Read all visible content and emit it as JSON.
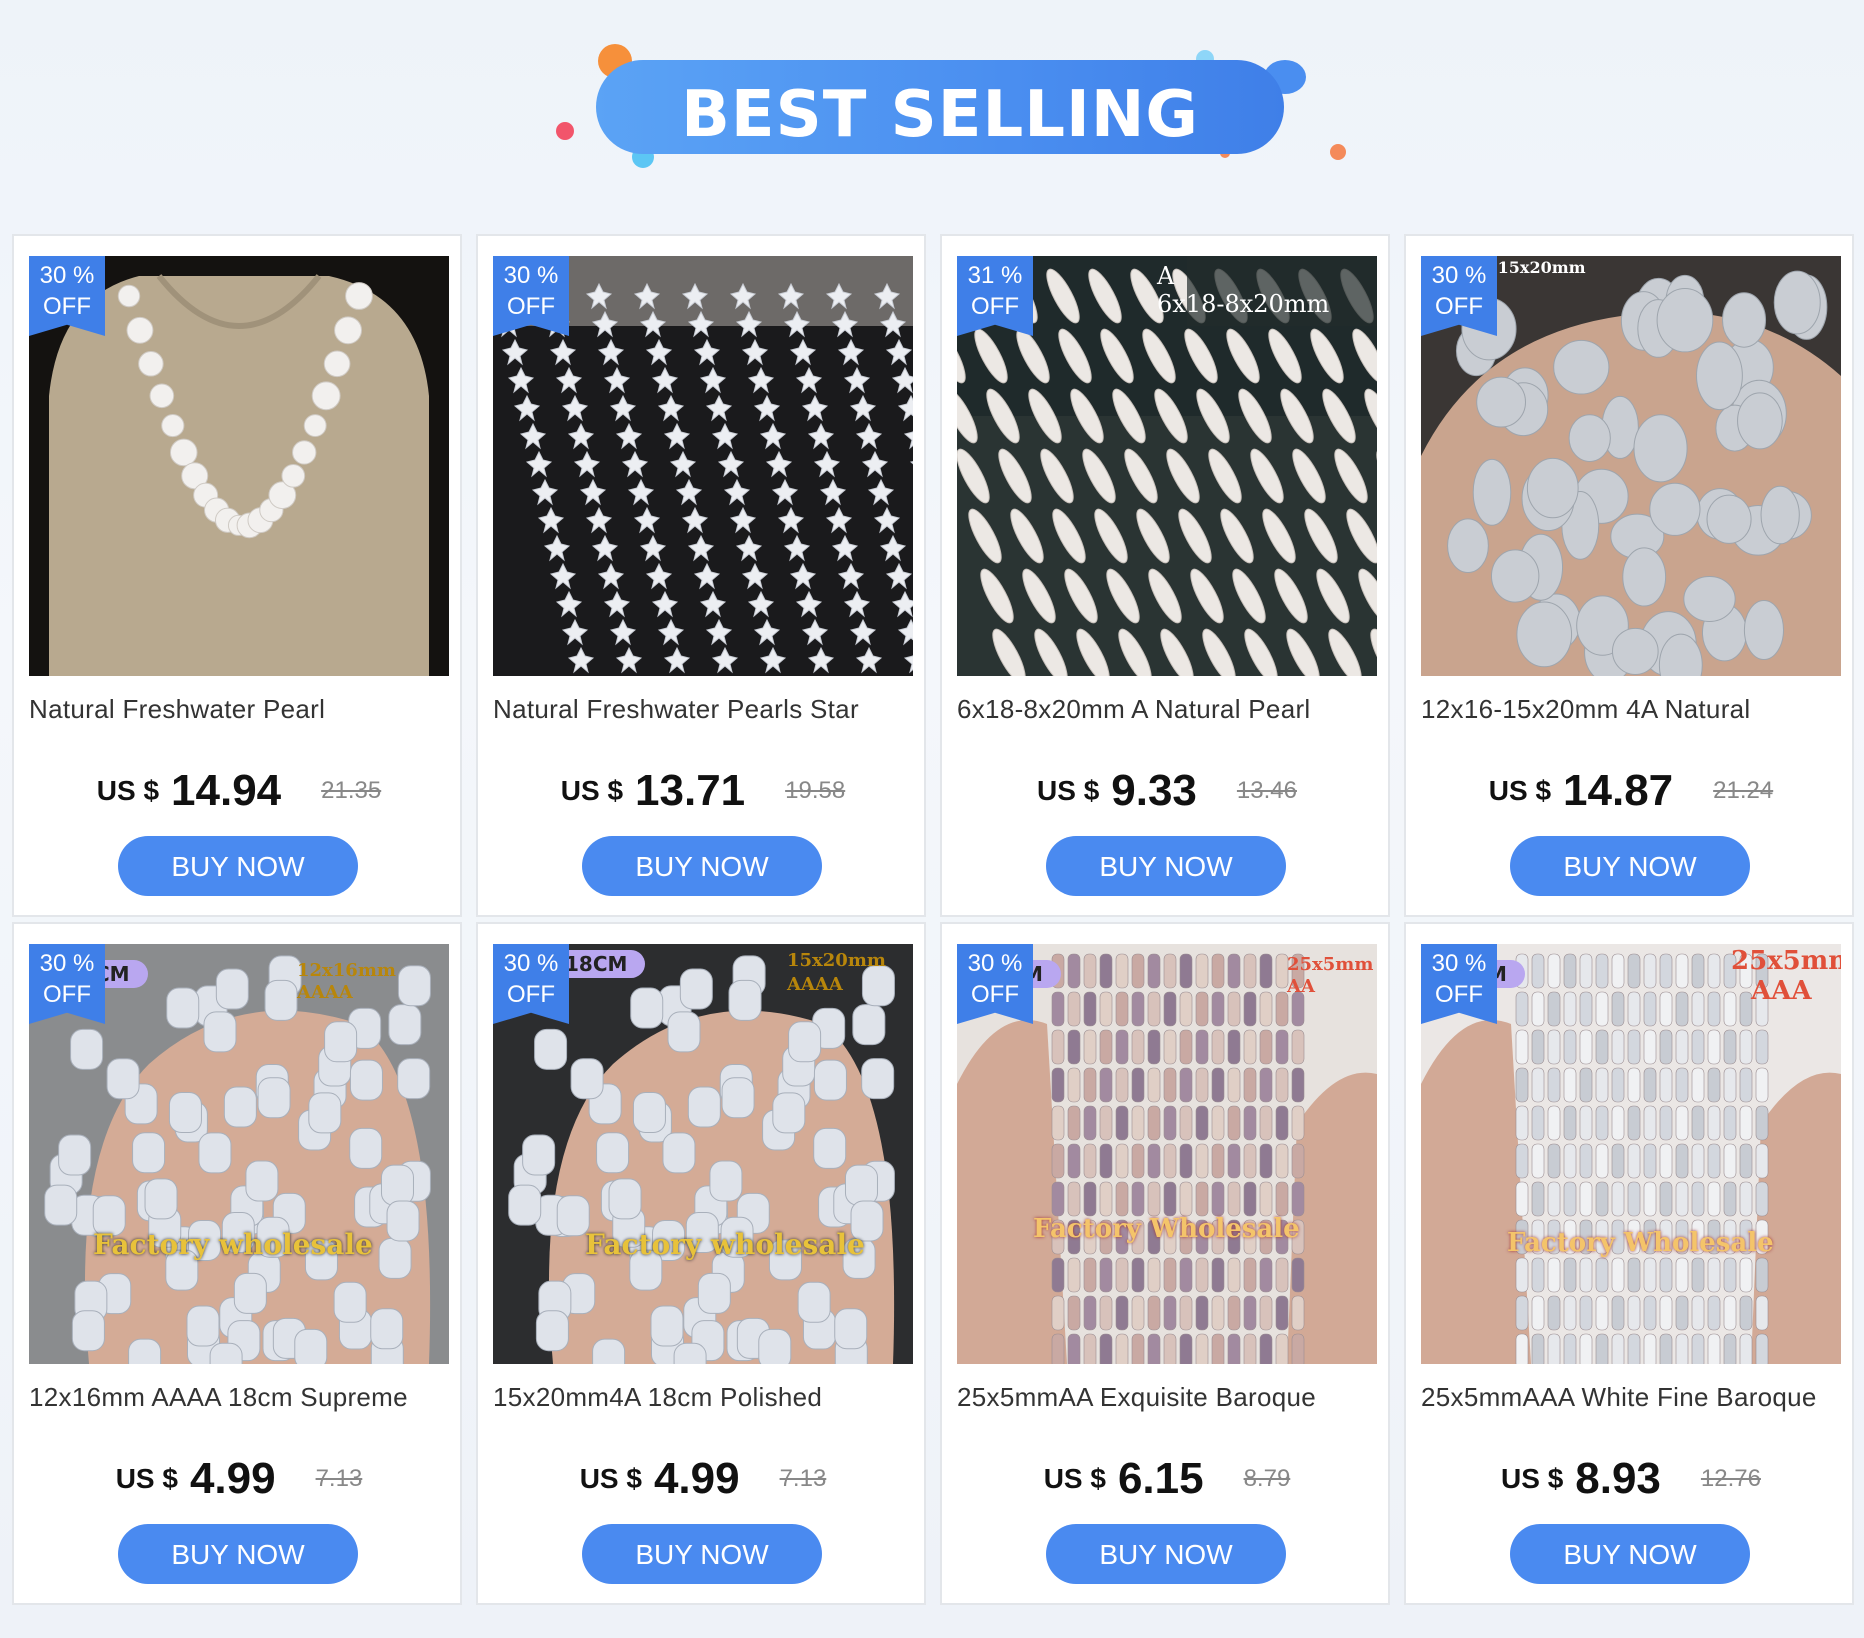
{
  "banner": {
    "title": "BEST SELLING"
  },
  "products": [
    {
      "discount_value": "30 %",
      "discount_label": "OFF",
      "title": "Natural Freshwater Pearl",
      "currency": "US $",
      "price": "14.94",
      "old_price": "21.35",
      "button": "BUY NOW",
      "image_text": [],
      "image": "pearl-necklace-bust"
    },
    {
      "discount_value": "30 %",
      "discount_label": "OFF",
      "title": "Natural Freshwater Pearls Star",
      "currency": "US $",
      "price": "13.71",
      "old_price": "19.58",
      "button": "BUY NOW",
      "image_text": [],
      "image": "star-pearl-strands"
    },
    {
      "discount_value": "31 %",
      "discount_label": "OFF",
      "title": "6x18-8x20mm A Natural Pearl",
      "currency": "US $",
      "price": "9.33",
      "old_price": "13.46",
      "button": "BUY NOW",
      "image_text": [
        "A",
        "6x18-8x20mm"
      ],
      "image": "stick-pearl-strands"
    },
    {
      "discount_value": "30 %",
      "discount_label": "OFF",
      "title": "12x16-15x20mm 4A Natural",
      "currency": "US $",
      "price": "14.87",
      "old_price": "21.24",
      "button": "BUY NOW",
      "image_text": [
        "-15x20mm"
      ],
      "image": "baroque-pearls-hand"
    },
    {
      "discount_value": "30 %",
      "discount_label": "OFF",
      "title": "12x16mm AAAA 18cm Supreme",
      "currency": "US $",
      "price": "4.99",
      "old_price": "7.13",
      "button": "BUY NOW",
      "image_text": [
        "CM",
        "12x16mm",
        "AAAA",
        "Factory wholesale"
      ],
      "image": "flat-pearls-hand"
    },
    {
      "discount_value": "30 %",
      "discount_label": "OFF",
      "title": "15x20mm4A 18cm Polished",
      "currency": "US $",
      "price": "4.99",
      "old_price": "7.13",
      "button": "BUY NOW",
      "image_text": [
        "18CM",
        "15x20mm",
        "AAAA",
        "Factory wholesale"
      ],
      "image": "coin-pearls-hand"
    },
    {
      "discount_value": "30 %",
      "discount_label": "OFF",
      "title": "25x5mmAA Exquisite Baroque",
      "currency": "US $",
      "price": "6.15",
      "old_price": "8.79",
      "button": "BUY NOW",
      "image_text": [
        "M",
        "25x5mm",
        "AA",
        "Factory Wholesale"
      ],
      "image": "purple-stick-pearls"
    },
    {
      "discount_value": "30 %",
      "discount_label": "OFF",
      "title": "25x5mmAAA White Fine Baroque",
      "currency": "US $",
      "price": "8.93",
      "old_price": "12.76",
      "button": "BUY NOW",
      "image_text": [
        "M",
        "25x5mm",
        "AAA",
        "Factory Wholesale"
      ],
      "image": "white-stick-pearls"
    }
  ],
  "colors": {
    "accent": "#4a8af0",
    "badge": "#3f7fe8"
  }
}
